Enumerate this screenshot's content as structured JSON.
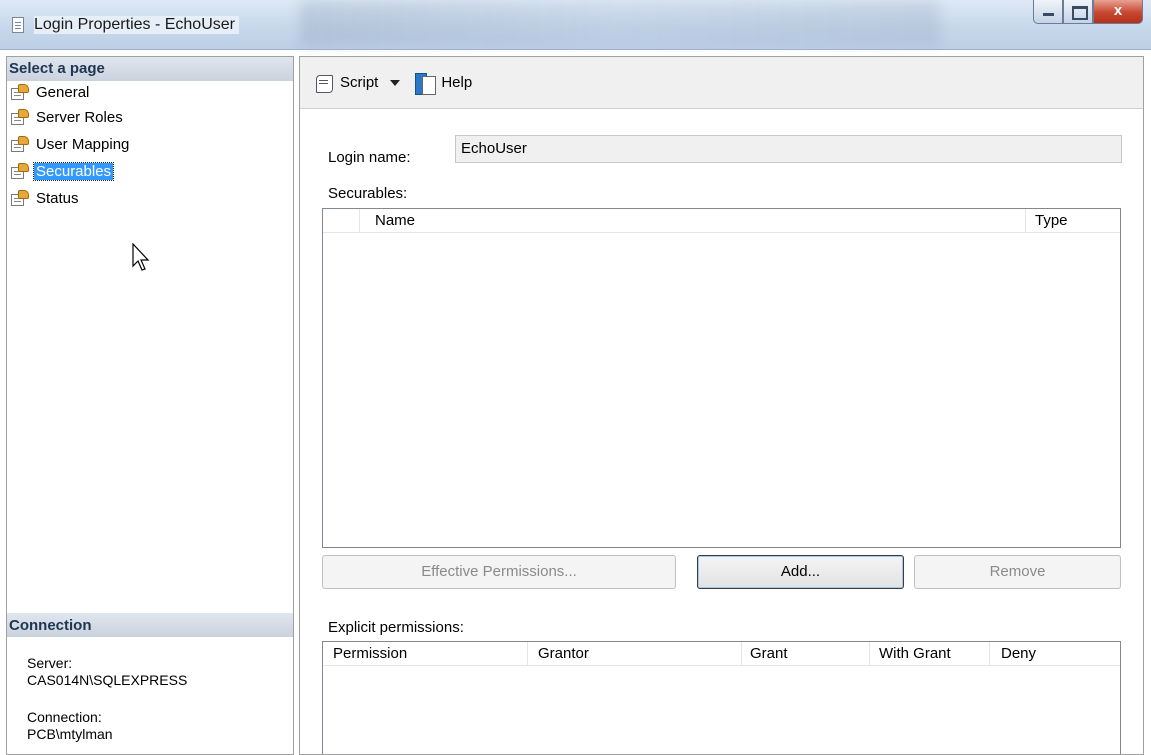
{
  "window": {
    "title": "Login Properties - EchoUser",
    "buttons": {
      "minimize": "",
      "maximize": "",
      "close": "x"
    }
  },
  "left": {
    "header": "Select a page",
    "pages": [
      {
        "label": "General",
        "selected": false
      },
      {
        "label": "Server Roles",
        "selected": false
      },
      {
        "label": "User Mapping",
        "selected": false
      },
      {
        "label": "Securables",
        "selected": true
      },
      {
        "label": "Status",
        "selected": false
      }
    ],
    "connection_header": "Connection",
    "server_label": "Server:",
    "server_value": "CAS014N\\SQLEXPRESS",
    "connection_label": "Connection:",
    "connection_value": "PCB\\mtylman"
  },
  "toolbar": {
    "script_label": "Script",
    "help_label": "Help"
  },
  "form": {
    "login_name_label": "Login name:",
    "login_name_value": "EchoUser",
    "securables_label": "Securables:",
    "securables_columns": [
      "Name",
      "Type"
    ],
    "securables_rows": [],
    "effective_permissions_label": "Effective Permissions...",
    "add_label": "Add...",
    "remove_label": "Remove",
    "explicit_permissions_label": "Explicit permissions:",
    "permission_columns": [
      "Permission",
      "Grantor",
      "Grant",
      "With Grant",
      "Deny"
    ],
    "permission_rows": []
  },
  "colors": {
    "selection": "#3399ff",
    "section_header_text": "#1f3552",
    "close_button": "#c7472f"
  }
}
